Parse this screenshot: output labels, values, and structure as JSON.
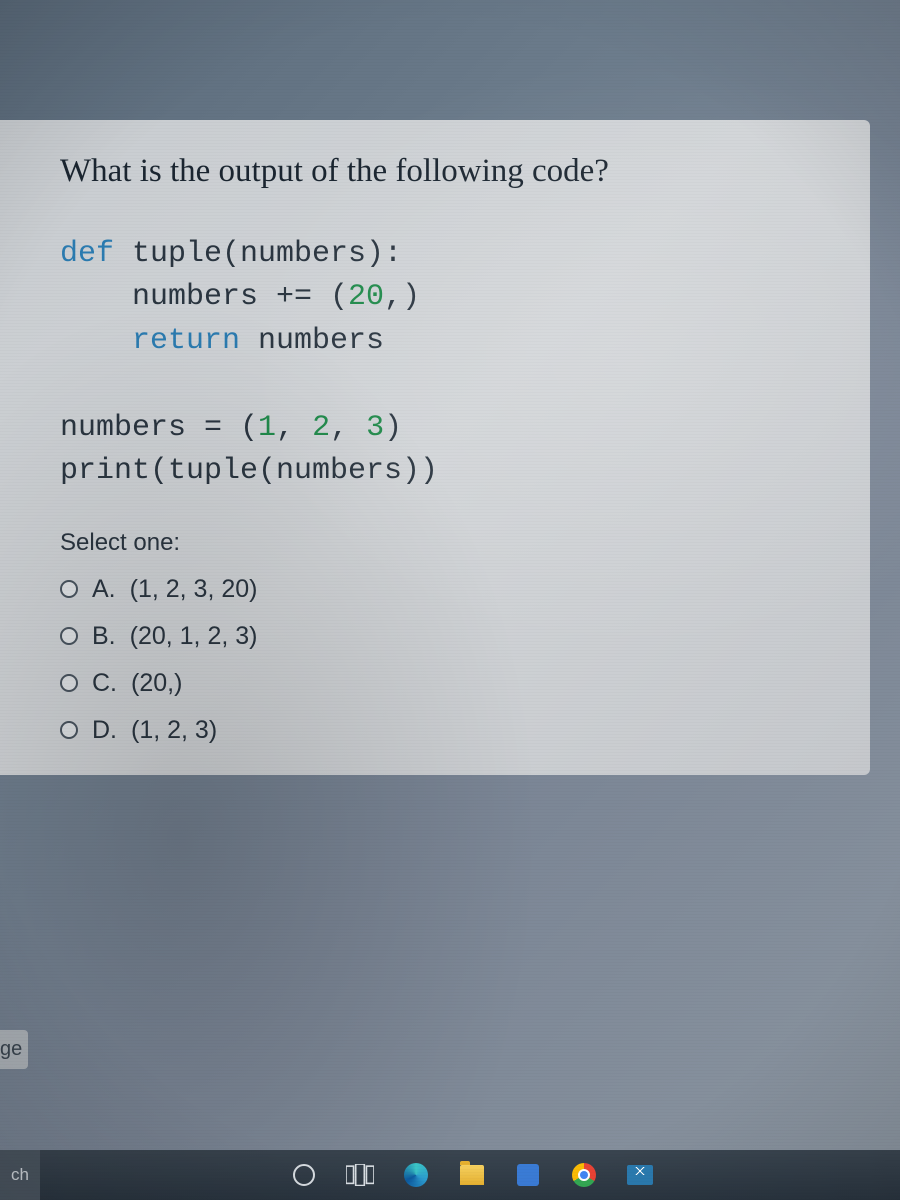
{
  "question": {
    "text": "What is the output of the following code?",
    "code": {
      "line1_kw": "def",
      "line1_rest": " tuple(numbers):",
      "line2a": "    numbers += (",
      "line2_num": "20",
      "line2b": ",)",
      "line3_kw": "    return",
      "line3_rest": " numbers",
      "blank": "",
      "line4a": "numbers = (",
      "line4_n1": "1",
      "line4_s1": ", ",
      "line4_n2": "2",
      "line4_s2": ", ",
      "line4_n3": "3",
      "line4b": ")",
      "line5": "print(tuple(numbers))"
    },
    "prompt": "Select one:",
    "options": [
      {
        "letter": "A.",
        "text": "(1, 2, 3, 20)"
      },
      {
        "letter": "B.",
        "text": "(20, 1, 2, 3)"
      },
      {
        "letter": "C.",
        "text": "(20,)"
      },
      {
        "letter": "D.",
        "text": "(1, 2, 3)"
      }
    ]
  },
  "nav": {
    "page_fragment": "ge"
  },
  "taskbar": {
    "search_fragment": "ch"
  }
}
